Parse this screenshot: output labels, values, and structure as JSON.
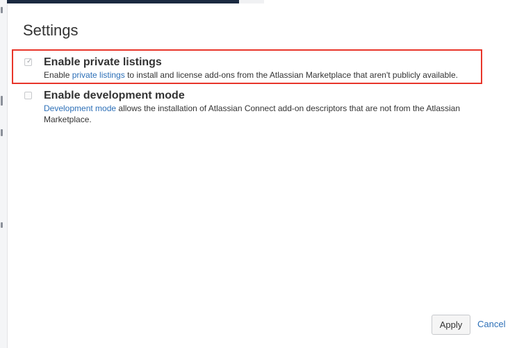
{
  "dialog": {
    "title": "Settings"
  },
  "options": [
    {
      "label": "Enable private listings",
      "checked": true,
      "description_before": "Enable ",
      "description_link": "private listings",
      "description_after": " to install and license add-ons from the Atlassian Marketplace that aren't publicly available."
    },
    {
      "label": "Enable development mode",
      "checked": false,
      "description_before": "",
      "description_link": "Development mode",
      "description_after": " allows the installation of Atlassian Connect add-on descriptors that are not from the Atlassian Marketplace."
    }
  ],
  "footer": {
    "apply_label": "Apply",
    "cancel_label": "Cancel"
  },
  "colors": {
    "link": "#2c6fb7",
    "highlight": "#e8352a"
  }
}
